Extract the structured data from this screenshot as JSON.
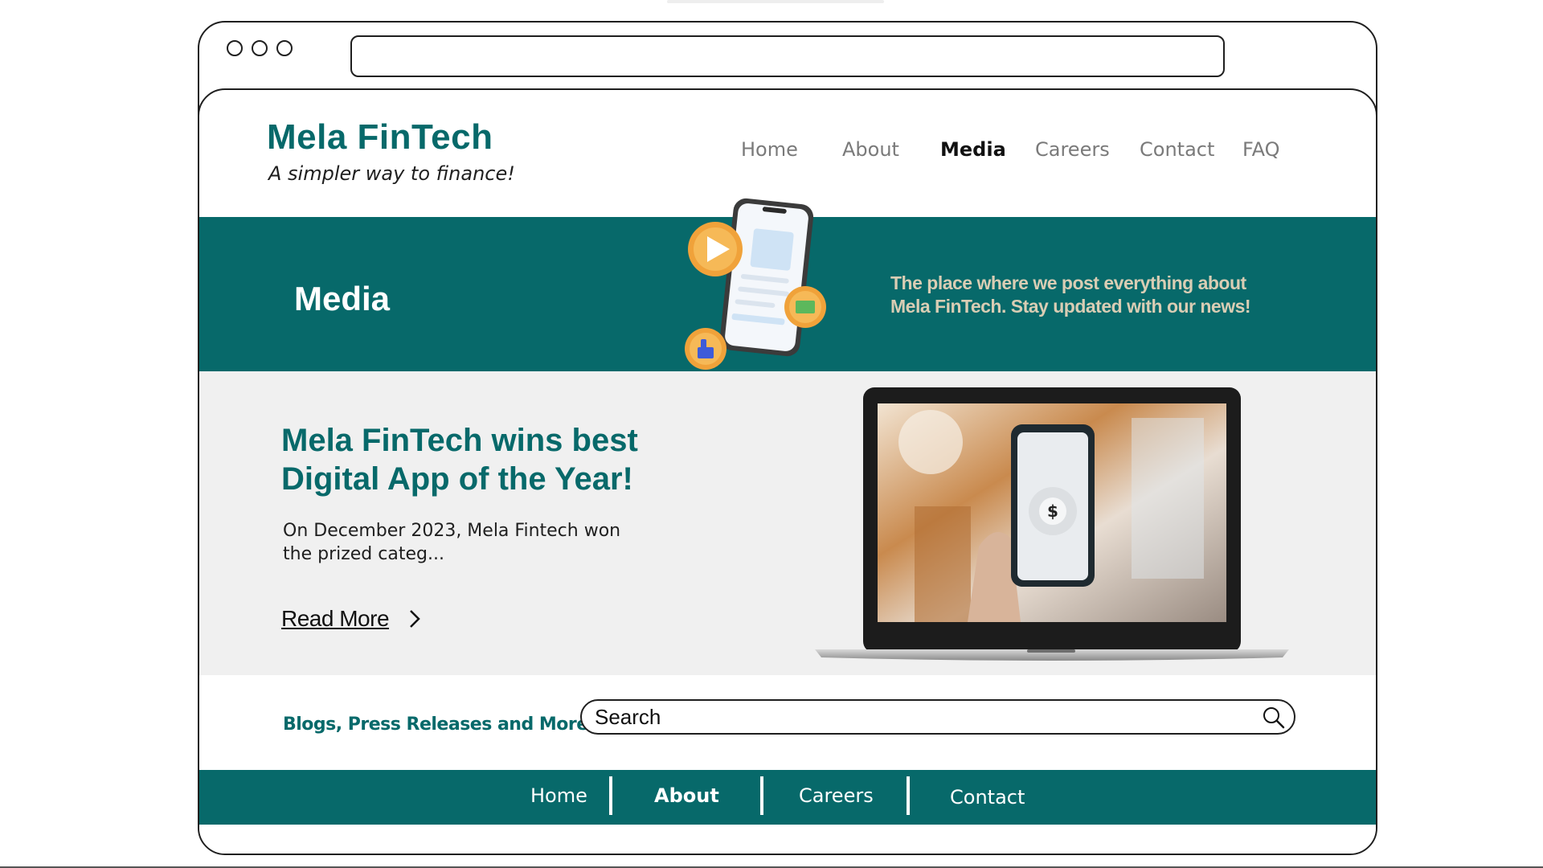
{
  "browser": {
    "url": ""
  },
  "brand": {
    "title": "Mela FinTech",
    "tagline": "A simpler way to finance!"
  },
  "top_nav": {
    "items": [
      {
        "label": "Home",
        "active": false
      },
      {
        "label": "About",
        "active": false
      },
      {
        "label": "Media",
        "active": true
      },
      {
        "label": "Careers",
        "active": false
      },
      {
        "label": "Contact",
        "active": false
      },
      {
        "label": "FAQ",
        "active": false
      }
    ]
  },
  "banner": {
    "title": "Media",
    "description": "The place where we post everything about Mela FinTech. Stay updated with our news!"
  },
  "feature": {
    "headline": "Mela FinTech wins best Digital App of the Year!",
    "excerpt": "On December 2023, Mela Fintech won the prized categ...",
    "read_more": "Read More",
    "image_screen_symbol": "$"
  },
  "search": {
    "caption": "Blogs, Press Releases and More!",
    "placeholder": "Search"
  },
  "footer_nav": {
    "items": [
      {
        "label": "Home"
      },
      {
        "label": "About"
      },
      {
        "label": "Careers"
      },
      {
        "label": "Contact"
      }
    ]
  },
  "icons": {
    "search": "search-icon",
    "read_more": "chevron-right-icon",
    "play": "play-icon",
    "message": "message-icon",
    "like": "thumbs-up-icon"
  },
  "colors": {
    "brand_teal": "#07696a",
    "banner_text": "#d9cdb4",
    "feature_bg": "#f0f0f0",
    "nav_inactive": "#7a7a7a",
    "orange_accent": "#f0a23a"
  }
}
